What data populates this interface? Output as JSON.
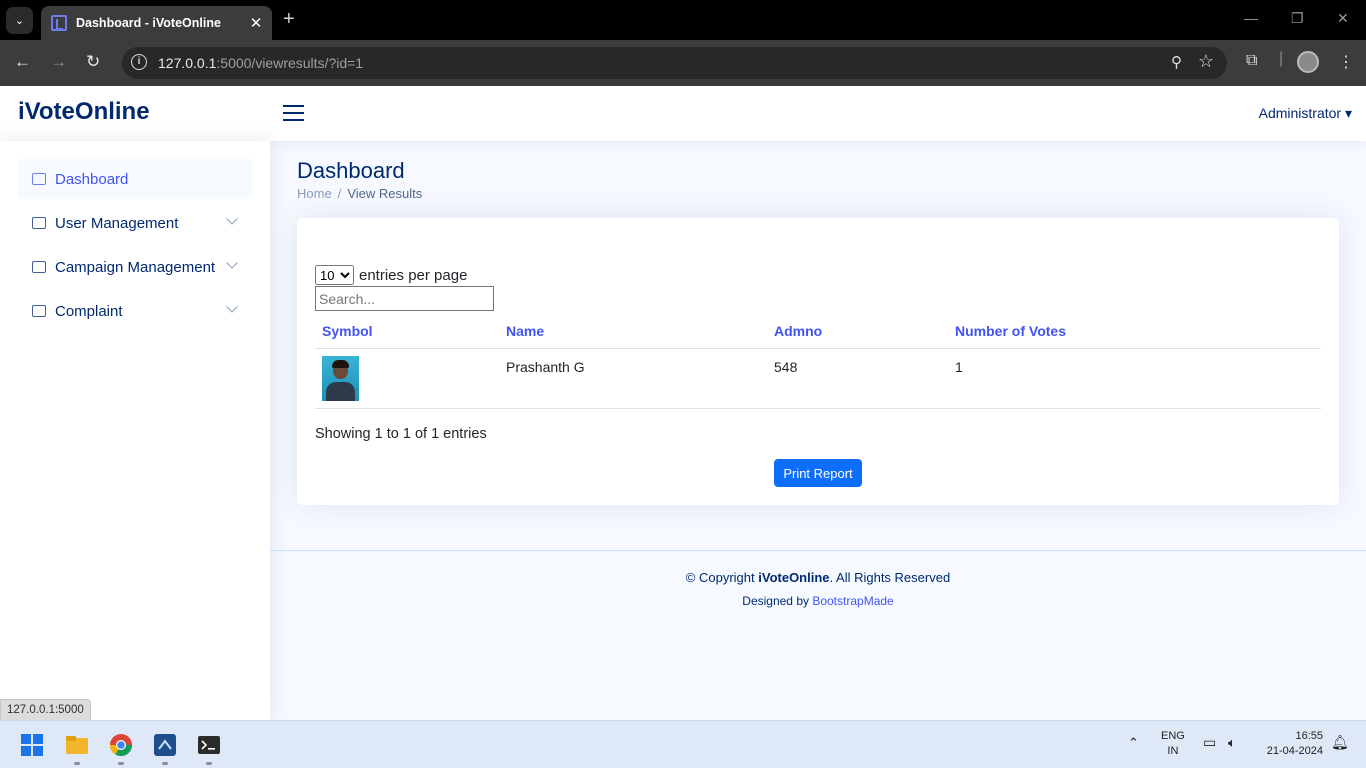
{
  "browser": {
    "tab_title": "Dashboard - iVoteOnline",
    "url_host": "127.0.0.1",
    "url_rest": ":5000/viewresults/?id=1",
    "status_url": "127.0.0.1:5000"
  },
  "app": {
    "logo": "iVoteOnline",
    "user_menu": "Administrator"
  },
  "sidebar": {
    "items": [
      {
        "label": "Dashboard"
      },
      {
        "label": "User Management"
      },
      {
        "label": "Campaign Management"
      },
      {
        "label": "Complaint"
      }
    ]
  },
  "page": {
    "title": "Dashboard",
    "breadcrumb_home": "Home",
    "breadcrumb_sep": "/",
    "breadcrumb_current": "View Results"
  },
  "table": {
    "page_size": "10",
    "entries_label": "entries per page",
    "search_placeholder": "Search...",
    "headers": [
      "Symbol",
      "Name",
      "Admno",
      "Number of Votes"
    ],
    "rows": [
      {
        "name": "Prashanth G",
        "admno": "548",
        "votes": "1"
      }
    ],
    "showing": "Showing 1 to 1 of 1 entries",
    "print_button": "Print Report"
  },
  "footer": {
    "copyright_prefix": "© Copyright ",
    "copyright_brand": "iVoteOnline",
    "copyright_suffix": ". All Rights Reserved",
    "designed_by": "Designed by ",
    "designer": "BootstrapMade"
  },
  "taskbar": {
    "lang_top": "ENG",
    "lang_bottom": "IN",
    "time": "16:55",
    "date": "21-04-2024"
  }
}
